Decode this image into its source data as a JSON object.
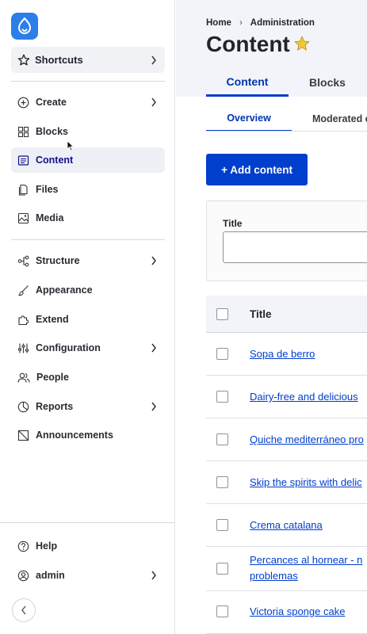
{
  "sidebar": {
    "shortcuts_label": "Shortcuts",
    "items_group1": [
      {
        "label": "Create",
        "icon": "plus-circle-icon",
        "chevron": true
      },
      {
        "label": "Blocks",
        "icon": "blocks-grid-icon",
        "chevron": false
      },
      {
        "label": "Content",
        "icon": "content-list-icon",
        "chevron": false,
        "active": true
      },
      {
        "label": "Files",
        "icon": "files-icon",
        "chevron": false
      },
      {
        "label": "Media",
        "icon": "media-icon",
        "chevron": false
      }
    ],
    "items_group2": [
      {
        "label": "Structure",
        "icon": "structure-icon",
        "chevron": true
      },
      {
        "label": "Appearance",
        "icon": "brush-icon",
        "chevron": false
      },
      {
        "label": "Extend",
        "icon": "puzzle-icon",
        "chevron": false
      },
      {
        "label": "Configuration",
        "icon": "sliders-icon",
        "chevron": true
      },
      {
        "label": "People",
        "icon": "people-icon",
        "chevron": false
      },
      {
        "label": "Reports",
        "icon": "chart-pie-icon",
        "chevron": true
      },
      {
        "label": "Announcements",
        "icon": "announcement-icon",
        "chevron": false
      }
    ],
    "help_label": "Help",
    "user_label": "admin"
  },
  "header": {
    "breadcrumb": [
      "Home",
      "Administration"
    ],
    "title": "Content",
    "tabs": [
      "Content",
      "Blocks"
    ],
    "subtabs": [
      "Overview",
      "Moderated c"
    ]
  },
  "actions": {
    "add_label": "+ Add content"
  },
  "filter": {
    "title_label": "Title",
    "title_value": ""
  },
  "table": {
    "header_title": "Title",
    "rows": [
      [
        "Sopa de berro"
      ],
      [
        "Dairy-free and delicious"
      ],
      [
        "Quiche mediterráneo pro"
      ],
      [
        "Skip the spirits with delic"
      ],
      [
        "Crema catalana"
      ],
      [
        "Percances al hornear - n",
        "problemas"
      ],
      [
        "Victoria sponge cake"
      ]
    ]
  },
  "colors": {
    "accent": "#003ecc",
    "logo": "#2c7ee8",
    "header_bg": "#f3f4f9",
    "star": "#f0c83c"
  }
}
